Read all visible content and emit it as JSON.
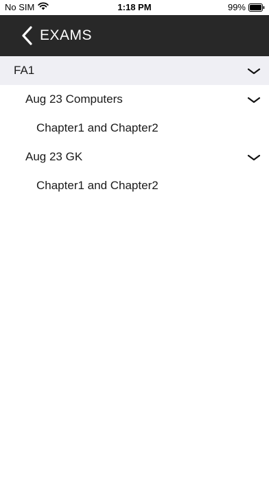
{
  "status_bar": {
    "carrier": "No SIM",
    "time": "1:18 PM",
    "battery": "99%"
  },
  "nav": {
    "title": "EXAMS",
    "back_icon": "chevron-left-icon"
  },
  "list": {
    "group": {
      "label": "FA1",
      "icon": "chevron-down-icon"
    },
    "exams": [
      {
        "label": "Aug 23 Computers",
        "chapter": "Chapter1 and Chapter2"
      },
      {
        "label": "Aug 23 GK",
        "chapter": "Chapter1 and Chapter2"
      }
    ]
  },
  "colors": {
    "nav_background": "#282828",
    "group_background": "#efeff4"
  }
}
